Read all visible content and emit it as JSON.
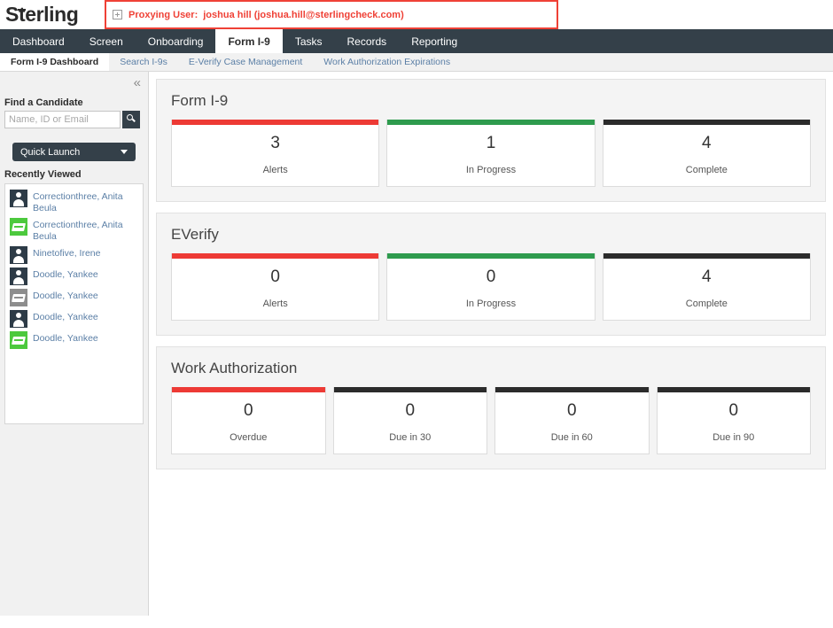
{
  "header": {
    "logo_text": "Sterling",
    "logo_part_a": "S",
    "logo_part_t": "t",
    "logo_part_b": "erling",
    "proxy_icon": "expand-square-plus-icon",
    "proxy_label": "Proxying User:",
    "proxy_user": "joshua hill (joshua.hill@sterlingcheck.com)",
    "accent_red": "#EF4136",
    "nav_bg": "#344049"
  },
  "mainnav": {
    "items": [
      {
        "label": "Dashboard",
        "active": false
      },
      {
        "label": "Screen",
        "active": false
      },
      {
        "label": "Onboarding",
        "active": false
      },
      {
        "label": "Form I-9",
        "active": true
      },
      {
        "label": "Tasks",
        "active": false
      },
      {
        "label": "Records",
        "active": false
      },
      {
        "label": "Reporting",
        "active": false
      }
    ]
  },
  "subnav": {
    "items": [
      {
        "label": "Form I-9 Dashboard",
        "active": true
      },
      {
        "label": "Search I-9s",
        "active": false
      },
      {
        "label": "E-Verify Case Management",
        "active": false
      },
      {
        "label": "Work Authorization Expirations",
        "active": false
      }
    ]
  },
  "sidebar": {
    "collapse_icon": "chevron-double-left-icon",
    "find_candidate_heading": "Find a Candidate",
    "search_placeholder": "Name, ID or Email",
    "search_value": "",
    "search_icon": "magnifier-icon",
    "quick_launch_label": "Quick Launch",
    "quick_launch_icon": "chevron-down-icon",
    "recently_viewed_heading": "Recently Viewed",
    "recent_items": [
      {
        "icon": "person-avatar-icon",
        "icon_style": "person",
        "label": "Correctionthree, Anita Beula"
      },
      {
        "icon": "document-icon-green",
        "icon_style": "doc-green",
        "label": "Correctionthree, Anita Beula"
      },
      {
        "icon": "person-avatar-icon",
        "icon_style": "person",
        "label": "Ninetofive, Irene"
      },
      {
        "icon": "person-avatar-icon",
        "icon_style": "person",
        "label": "Doodle, Yankee"
      },
      {
        "icon": "document-icon-gray",
        "icon_style": "doc-gray",
        "label": "Doodle, Yankee"
      },
      {
        "icon": "person-avatar-icon",
        "icon_style": "person",
        "label": "Doodle, Yankee"
      },
      {
        "icon": "document-icon-green",
        "icon_style": "doc-green",
        "label": "Doodle, Yankee"
      }
    ]
  },
  "panels": [
    {
      "title": "Form I-9",
      "tiles": [
        {
          "count": "3",
          "label": "Alerts",
          "color": "#ED3A35"
        },
        {
          "count": "1",
          "label": "In Progress",
          "color": "#2E9B4E"
        },
        {
          "count": "4",
          "label": "Complete",
          "color": "#2B2B2B"
        }
      ]
    },
    {
      "title": "EVerify",
      "tiles": [
        {
          "count": "0",
          "label": "Alerts",
          "color": "#ED3A35"
        },
        {
          "count": "0",
          "label": "In Progress",
          "color": "#2E9B4E"
        },
        {
          "count": "4",
          "label": "Complete",
          "color": "#2B2B2B"
        }
      ]
    },
    {
      "title": "Work Authorization",
      "tiles": [
        {
          "count": "0",
          "label": "Overdue",
          "color": "#ED3A35"
        },
        {
          "count": "0",
          "label": "Due in 30",
          "color": "#2B2B2B"
        },
        {
          "count": "0",
          "label": "Due in 60",
          "color": "#2B2B2B"
        },
        {
          "count": "0",
          "label": "Due in 90",
          "color": "#2B2B2B"
        }
      ]
    }
  ]
}
